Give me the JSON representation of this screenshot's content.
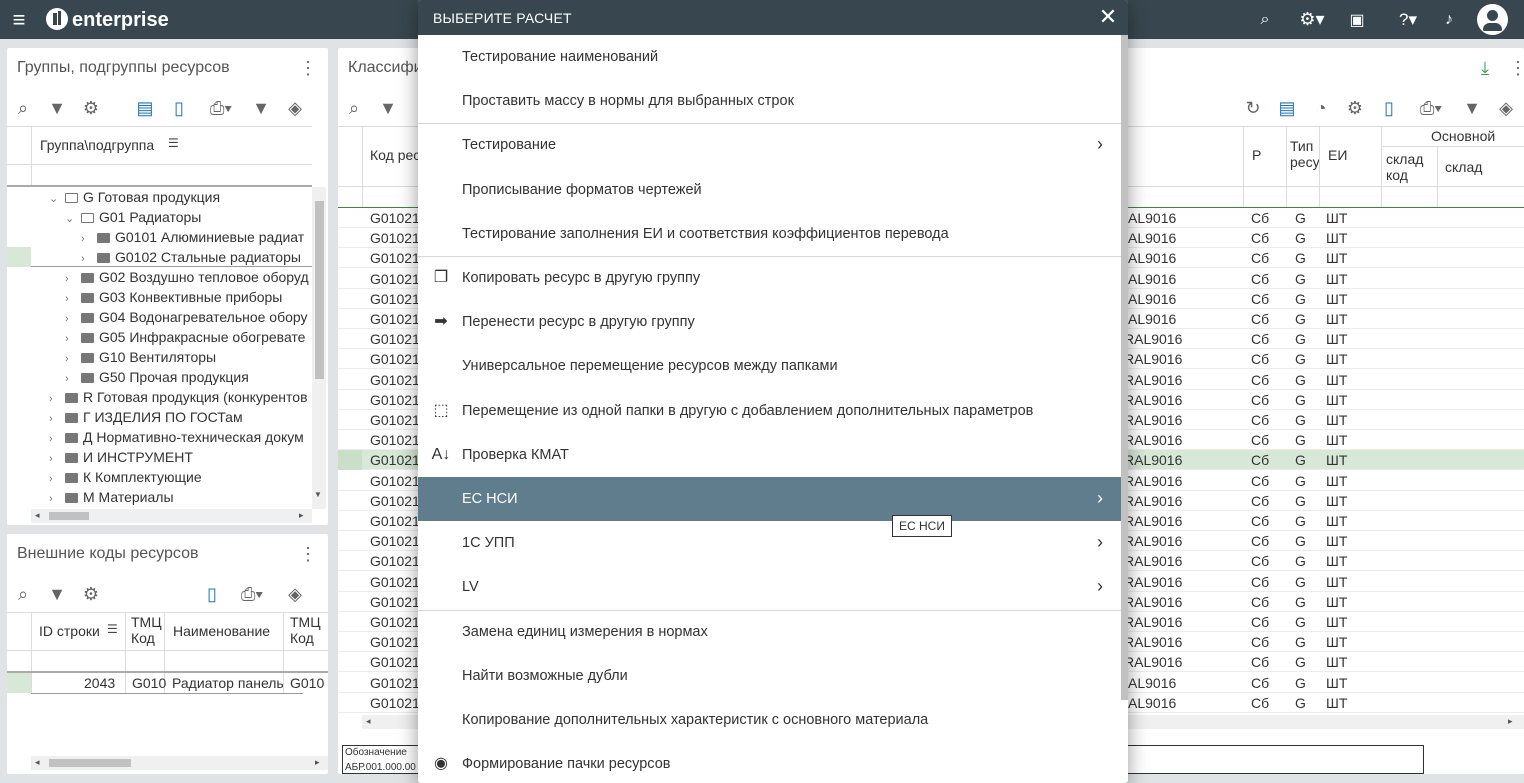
{
  "app": {
    "brand": "enterprise"
  },
  "topbar": {
    "icons": [
      "menu-icon",
      "search-icon",
      "gear-icon",
      "archive-icon",
      "help-icon",
      "bell-icon",
      "account-icon"
    ]
  },
  "groups_panel": {
    "title": "Группы, подгруппы ресурсов",
    "column": "Группа\\подгруппа",
    "tree": [
      {
        "label": "G Готовая продукция",
        "level": 0,
        "open": true
      },
      {
        "label": "G01 Радиаторы",
        "level": 1,
        "open": true
      },
      {
        "label": "G0101 Алюминиевые радиат",
        "level": 2,
        "open": false
      },
      {
        "label": "G0102 Стальные радиаторы",
        "level": 2,
        "open": false
      },
      {
        "label": "G02 Воздушно тепловое оборуд",
        "level": 1,
        "open": false
      },
      {
        "label": "G03 Конвективные приборы",
        "level": 1,
        "open": false
      },
      {
        "label": "G04 Водонагревательное обору",
        "level": 1,
        "open": false
      },
      {
        "label": "G05 Инфракрасные обогревате",
        "level": 1,
        "open": false
      },
      {
        "label": "G10 Вентиляторы",
        "level": 1,
        "open": false
      },
      {
        "label": "G50 Прочая продукция",
        "level": 1,
        "open": false
      },
      {
        "label": "R Готовая продукция (конкурентов",
        "level": 0,
        "open": false
      },
      {
        "label": "Г ИЗДЕЛИЯ ПО ГОСТам",
        "level": 0,
        "open": false
      },
      {
        "label": "Д Нормативно-техническая докум",
        "level": 0,
        "open": false
      },
      {
        "label": "И ИНСТРУМЕНТ",
        "level": 0,
        "open": false
      },
      {
        "label": "К Комплектующие",
        "level": 0,
        "open": false
      },
      {
        "label": "М Материалы",
        "level": 0,
        "open": false
      }
    ]
  },
  "extcodes_panel": {
    "title": "Внешние коды ресурсов",
    "columns": [
      "ID строки",
      "ТМЦ Код",
      "Наименование",
      "ТМЦ Код"
    ],
    "row": [
      "2043",
      "G010",
      "Радиатор панель",
      "G010"
    ]
  },
  "main_panel": {
    "title": "Классифи",
    "col_code": "Код рес",
    "col_p": "Р",
    "col_type": "Тип ресу",
    "col_ei": "ЕИ",
    "col_main": "Основной",
    "col_sklad_code": "склад код",
    "col_sklad": "склад",
    "row_code": "G01021",
    "rows_name": [
      "AL9016",
      "AL9016",
      "AL9016",
      "AL9016",
      "AL9016",
      "AL9016",
      "RAL9016",
      "RAL9016",
      "RAL9016",
      "RAL9016",
      "RAL9016",
      "RAL9016",
      "RAL9016",
      "RAL9016",
      "RAL9016",
      "RAL9016",
      "RAL9016",
      "RAL9016",
      "RAL9016",
      "RAL9016",
      "RAL9016",
      "RAL9016",
      "RAL9016",
      "AL9016",
      "AL9016"
    ],
    "row_p": "Сб",
    "row_type": "G",
    "row_ei": "ШТ",
    "footer_label": "Обозначение",
    "footer_value": "АБР.001.000.00"
  },
  "dialog": {
    "title": "ВЫБЕРИТЕ РАСЧЕТ",
    "items": [
      {
        "label": "Тестирование наименований",
        "icon": "",
        "arrow": false
      },
      {
        "label": "Проставить массу в нормы для выбранных строк",
        "icon": "",
        "arrow": false
      },
      {
        "label": "Тестирование",
        "icon": "",
        "arrow": true
      },
      {
        "label": "Прописывание форматов чертежей",
        "icon": "",
        "arrow": false
      },
      {
        "label": "Тестирование заполнения ЕИ и соответствия коэффициентов перевода",
        "icon": "",
        "arrow": false
      },
      {
        "label": "Копировать ресурс в другую группу",
        "icon": "copy-icon",
        "arrow": false
      },
      {
        "label": "Перенести ресурс в другую группу",
        "icon": "move-folder-icon",
        "arrow": false
      },
      {
        "label": "Универсальное перемещение ресурсов между папками",
        "icon": "",
        "arrow": false
      },
      {
        "label": "Перемещение из одной папки в другую с добавлением дополнительных параметров",
        "icon": "select-area-icon",
        "arrow": false
      },
      {
        "label": "Проверка КМАТ",
        "icon": "sort-az-icon",
        "arrow": false
      },
      {
        "label": "ЕС НСИ",
        "icon": "",
        "arrow": true
      },
      {
        "label": "1С УПП",
        "icon": "",
        "arrow": true
      },
      {
        "label": "LV",
        "icon": "",
        "arrow": true
      },
      {
        "label": "Замена единиц измерения в нормах",
        "icon": "",
        "arrow": false
      },
      {
        "label": "Найти возможные дубли",
        "icon": "",
        "arrow": false
      },
      {
        "label": "Копирование дополнительных характеристик с основного материала",
        "icon": "",
        "arrow": false
      },
      {
        "label": "Формирование пачки ресурсов",
        "icon": "target-icon",
        "arrow": false
      }
    ],
    "tooltip": "ЕС НСИ"
  },
  "colors": {
    "topbar": "#38474f",
    "highlight": "#5f7d8c",
    "selected_row": "#d7e8d6",
    "accent": "#1e73be"
  }
}
